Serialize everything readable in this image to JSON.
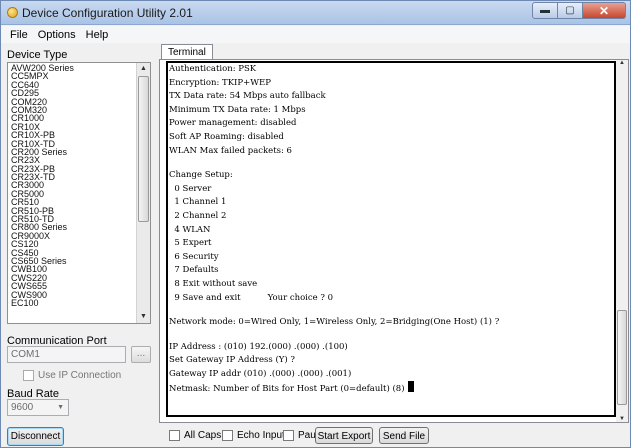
{
  "window": {
    "title": "Device Configuration Utility 2.01",
    "minimize_symbol": "▬",
    "maximize_symbol": "▢",
    "close_symbol": "✕"
  },
  "menubar": {
    "items": [
      {
        "label": "File"
      },
      {
        "label": "Options"
      },
      {
        "label": "Help"
      }
    ]
  },
  "device_type": {
    "label": "Device Type",
    "items": [
      "AVW200 Series",
      "CC5MPX",
      "CC640",
      "CD295",
      "COM220",
      "COM320",
      "CR1000",
      "CR10X",
      "CR10X-PB",
      "CR10X-TD",
      "CR200 Series",
      "CR23X",
      "CR23X-PB",
      "CR23X-TD",
      "CR3000",
      "CR5000",
      "CR510",
      "CR510-PB",
      "CR510-TD",
      "CR800 Series",
      "CR9000X",
      "CS120",
      "CS450",
      "CS650 Series",
      "CWB100",
      "CWS220",
      "CWS655",
      "CWS900",
      "EC100"
    ]
  },
  "communication_port": {
    "label": "Communication Port",
    "value": "COM1",
    "browse_label": "..."
  },
  "use_ip_connection": {
    "label": "Use IP Connection",
    "checked": false
  },
  "baud_rate": {
    "label": "Baud Rate",
    "value": "9600"
  },
  "disconnect_label": "Disconnect",
  "tabs": [
    {
      "label": "Terminal",
      "active": true
    }
  ],
  "terminal": {
    "lines": [
      "Authentication: PSK",
      "Encryption: TKIP+WEP",
      "TX Data rate: 54 Mbps auto fallback",
      "Minimum TX Data rate: 1 Mbps",
      "Power management: disabled",
      "Soft AP Roaming: disabled",
      "WLAN Max failed packets: 6",
      "",
      "Change Setup:",
      "  0 Server",
      "  1 Channel 1",
      "  2 Channel 2",
      "  4 WLAN",
      "  5 Expert",
      "  6 Security",
      "  7 Defaults",
      "  8 Exit without save",
      "  9 Save and exit          Your choice ? 0",
      "",
      "Network mode: 0=Wired Only, 1=Wireless Only, 2=Bridging(One Host) (1) ?",
      "",
      "IP Address : (010) 192.(000) .(000) .(100)",
      "Set Gateway IP Address (Y) ?",
      "Gateway IP addr (010) .(000) .(000) .(001)",
      "Netmask: Number of Bits for Host Part (0=default) (8)"
    ]
  },
  "bottom": {
    "all_caps": {
      "label": "All Caps",
      "checked": false
    },
    "echo_input": {
      "label": "Echo Input",
      "checked": false
    },
    "pause": {
      "label": "Pause",
      "checked": false
    },
    "start_export": "Start Export",
    "send_file": "Send File"
  }
}
